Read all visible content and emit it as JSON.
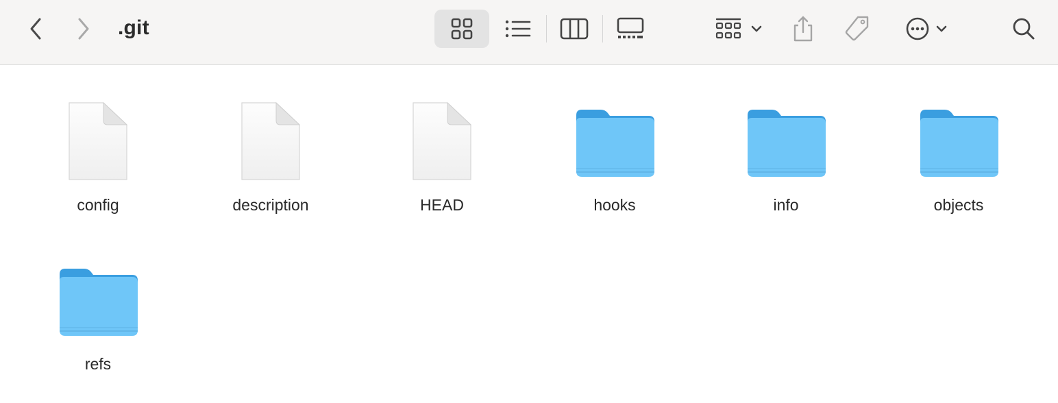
{
  "window": {
    "title": ".git"
  },
  "toolbar": {
    "back": {
      "icon": "chevron-left-icon"
    },
    "forward": {
      "icon": "chevron-right-icon"
    },
    "views": [
      {
        "name": "icon-view",
        "icon": "grid-icon",
        "selected": true
      },
      {
        "name": "list-view",
        "icon": "list-icon",
        "selected": false
      },
      {
        "name": "column-view",
        "icon": "columns-icon",
        "selected": false
      },
      {
        "name": "gallery-view",
        "icon": "gallery-icon",
        "selected": false
      }
    ],
    "group": {
      "icon": "group-grid-icon"
    },
    "share": {
      "icon": "share-icon"
    },
    "tags": {
      "icon": "tag-icon"
    },
    "more": {
      "icon": "ellipsis-circle-icon"
    },
    "search": {
      "icon": "search-icon"
    }
  },
  "items": [
    {
      "name": "config",
      "kind": "file"
    },
    {
      "name": "description",
      "kind": "file"
    },
    {
      "name": "HEAD",
      "kind": "file"
    },
    {
      "name": "hooks",
      "kind": "folder"
    },
    {
      "name": "info",
      "kind": "folder"
    },
    {
      "name": "objects",
      "kind": "folder"
    },
    {
      "name": "refs",
      "kind": "folder"
    }
  ],
  "colors": {
    "folder_body": "#6fc6f8",
    "folder_tab": "#3a9ee0",
    "toolbar_bg": "#f6f5f4",
    "icon_gray": "#5a5a5a"
  }
}
